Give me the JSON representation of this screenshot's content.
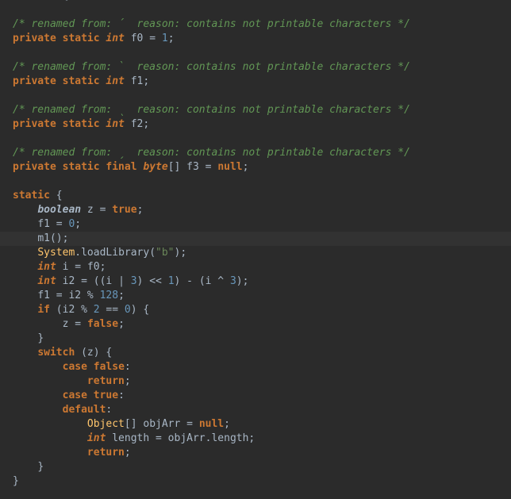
{
  "editor": {
    "colors": {
      "background": "#2b2b2b",
      "current_line": "#323232",
      "text": "#a9b7c6",
      "keyword": "#cc7832",
      "comment": "#629755",
      "number": "#6897bb",
      "string": "#6a8759",
      "class": "#ffc66d"
    },
    "lines": [
      {
        "indent": "",
        "tokens": [
          {
            "t": "        {",
            "c": "plain"
          }
        ]
      },
      {
        "indent": "",
        "tokens": []
      },
      {
        "indent": "",
        "tokens": [
          {
            "t": "/* renamed from: ´  reason: contains not printable characters */",
            "c": "comment"
          }
        ]
      },
      {
        "indent": "",
        "tokens": [
          {
            "t": "private static ",
            "c": "kw"
          },
          {
            "t": "int",
            "c": "kw-it"
          },
          {
            "t": " f0 = ",
            "c": "plain"
          },
          {
            "t": "1",
            "c": "num"
          },
          {
            "t": ";",
            "c": "plain"
          }
        ]
      },
      {
        "indent": "",
        "tokens": []
      },
      {
        "indent": "",
        "tokens": [
          {
            "t": "/* renamed from: `  reason: contains not printable characters */",
            "c": "comment"
          }
        ]
      },
      {
        "indent": "",
        "tokens": [
          {
            "t": "private static ",
            "c": "kw"
          },
          {
            "t": "int",
            "c": "kw-it"
          },
          {
            "t": " f1;",
            "c": "plain"
          }
        ]
      },
      {
        "indent": "",
        "tokens": []
      },
      {
        "indent": "",
        "tokens": [
          {
            "t": "/* renamed from: ˎ  reason: contains not printable characters */",
            "c": "comment"
          }
        ]
      },
      {
        "indent": "",
        "tokens": [
          {
            "t": "private static ",
            "c": "kw"
          },
          {
            "t": "int",
            "c": "kw-it"
          },
          {
            "t": " f2;",
            "c": "plain"
          }
        ]
      },
      {
        "indent": "",
        "tokens": []
      },
      {
        "indent": "",
        "tokens": [
          {
            "t": "/* renamed from: ˏ  reason: contains not printable characters */",
            "c": "comment"
          }
        ]
      },
      {
        "indent": "",
        "tokens": [
          {
            "t": "private static final ",
            "c": "kw"
          },
          {
            "t": "byte",
            "c": "kw-it"
          },
          {
            "t": "[] f3 = ",
            "c": "plain"
          },
          {
            "t": "null",
            "c": "kw"
          },
          {
            "t": ";",
            "c": "plain"
          }
        ]
      },
      {
        "indent": "",
        "tokens": []
      },
      {
        "indent": "",
        "tokens": [
          {
            "t": "static",
            "c": "kw"
          },
          {
            "t": " {",
            "c": "plain"
          }
        ]
      },
      {
        "indent": "    ",
        "tokens": [
          {
            "t": "boolean",
            "c": "type-it"
          },
          {
            "t": " z = ",
            "c": "plain"
          },
          {
            "t": "true",
            "c": "kw"
          },
          {
            "t": ";",
            "c": "plain"
          }
        ]
      },
      {
        "indent": "    ",
        "tokens": [
          {
            "t": "f1 = ",
            "c": "plain"
          },
          {
            "t": "0",
            "c": "num"
          },
          {
            "t": ";",
            "c": "plain"
          }
        ]
      },
      {
        "indent": "    ",
        "current": true,
        "tokens": [
          {
            "t": "m1();",
            "c": "plain"
          }
        ]
      },
      {
        "indent": "    ",
        "tokens": [
          {
            "t": "System",
            "c": "cls"
          },
          {
            "t": ".loadLibrary(",
            "c": "plain"
          },
          {
            "t": "\"b\"",
            "c": "str"
          },
          {
            "t": ");",
            "c": "plain"
          }
        ]
      },
      {
        "indent": "    ",
        "tokens": [
          {
            "t": "int",
            "c": "kw-it"
          },
          {
            "t": " i = f0;",
            "c": "plain"
          }
        ]
      },
      {
        "indent": "    ",
        "tokens": [
          {
            "t": "int",
            "c": "kw-it"
          },
          {
            "t": " i2 = ((i | ",
            "c": "plain"
          },
          {
            "t": "3",
            "c": "num"
          },
          {
            "t": ") << ",
            "c": "plain"
          },
          {
            "t": "1",
            "c": "num"
          },
          {
            "t": ") - (i ^ ",
            "c": "plain"
          },
          {
            "t": "3",
            "c": "num"
          },
          {
            "t": ");",
            "c": "plain"
          }
        ]
      },
      {
        "indent": "    ",
        "tokens": [
          {
            "t": "f1 = i2 % ",
            "c": "plain"
          },
          {
            "t": "128",
            "c": "num"
          },
          {
            "t": ";",
            "c": "plain"
          }
        ]
      },
      {
        "indent": "    ",
        "tokens": [
          {
            "t": "if",
            "c": "kw"
          },
          {
            "t": " (i2 % ",
            "c": "plain"
          },
          {
            "t": "2",
            "c": "num"
          },
          {
            "t": " == ",
            "c": "plain"
          },
          {
            "t": "0",
            "c": "num"
          },
          {
            "t": ") {",
            "c": "plain"
          }
        ]
      },
      {
        "indent": "        ",
        "tokens": [
          {
            "t": "z = ",
            "c": "plain"
          },
          {
            "t": "false",
            "c": "kw"
          },
          {
            "t": ";",
            "c": "plain"
          }
        ]
      },
      {
        "indent": "    ",
        "tokens": [
          {
            "t": "}",
            "c": "plain"
          }
        ]
      },
      {
        "indent": "    ",
        "tokens": [
          {
            "t": "switch",
            "c": "kw"
          },
          {
            "t": " (z) {",
            "c": "plain"
          }
        ]
      },
      {
        "indent": "        ",
        "tokens": [
          {
            "t": "case false",
            "c": "kw"
          },
          {
            "t": ":",
            "c": "plain"
          }
        ]
      },
      {
        "indent": "            ",
        "tokens": [
          {
            "t": "return",
            "c": "kw"
          },
          {
            "t": ";",
            "c": "plain"
          }
        ]
      },
      {
        "indent": "        ",
        "tokens": [
          {
            "t": "case true",
            "c": "kw"
          },
          {
            "t": ":",
            "c": "plain"
          }
        ]
      },
      {
        "indent": "        ",
        "tokens": [
          {
            "t": "default",
            "c": "kw"
          },
          {
            "t": ":",
            "c": "plain"
          }
        ]
      },
      {
        "indent": "            ",
        "tokens": [
          {
            "t": "Object",
            "c": "cls"
          },
          {
            "t": "[] objArr = ",
            "c": "plain"
          },
          {
            "t": "null",
            "c": "kw"
          },
          {
            "t": ";",
            "c": "plain"
          }
        ]
      },
      {
        "indent": "            ",
        "tokens": [
          {
            "t": "int",
            "c": "kw-it"
          },
          {
            "t": " length = objArr.length;",
            "c": "plain"
          }
        ]
      },
      {
        "indent": "            ",
        "tokens": [
          {
            "t": "return",
            "c": "kw"
          },
          {
            "t": ";",
            "c": "plain"
          }
        ]
      },
      {
        "indent": "    ",
        "tokens": [
          {
            "t": "}",
            "c": "plain"
          }
        ]
      },
      {
        "indent": "",
        "tokens": [
          {
            "t": "}",
            "c": "plain"
          }
        ]
      }
    ]
  }
}
